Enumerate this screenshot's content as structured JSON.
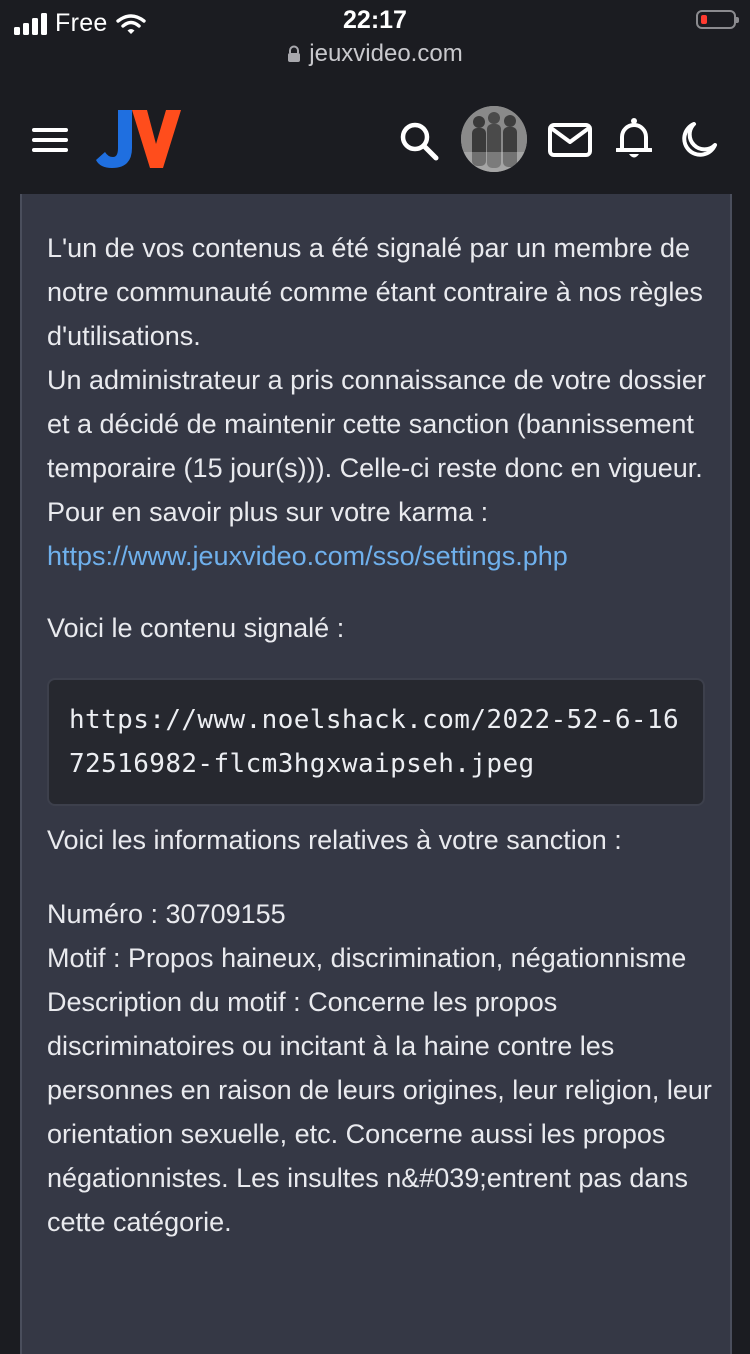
{
  "status_bar": {
    "carrier": "Free",
    "time": "22:17",
    "url": "jeuxvideo.com"
  },
  "header": {
    "logo_text": "JV",
    "icons": [
      "menu-icon",
      "search-icon",
      "avatar",
      "mail-icon",
      "bell-icon",
      "moon-icon"
    ]
  },
  "message": {
    "intro_lines": [
      "L'un de vos contenus a été signalé par un membre de notre communauté comme étant contraire à nos règles d'utilisations.",
      "Un administrateur a pris connaissance de votre dossier et a décidé de maintenir cette sanction (bannissement temporaire (15 jour(s))). Celle-ci reste donc en vigueur.",
      "Pour en savoir plus sur votre karma :"
    ],
    "karma_link": "https://www.jeuxvideo.com/sso/settings.php",
    "reported_heading": "Voici le contenu signalé :",
    "reported_content": "https://www.noelshack.com/2022-52-6-1672516982-flcm3hgxwaipseh.jpeg",
    "sanction_heading": "Voici les informations relatives à votre sanction :",
    "sanction": {
      "numero": "Numéro : 30709155",
      "motif": "Motif : Propos haineux, discrimination, négationnisme",
      "description": "Description du motif : Concerne les propos discriminatoires ou incitant à la haine contre les personnes en raison de leurs origines, leur religion, leur orientation sexuelle, etc. Concerne aussi les propos négationnistes. Les insultes n&#039;entrent pas dans cette catégorie."
    }
  },
  "colors": {
    "page_background": "#1b1c21",
    "card_background": "#353845",
    "link": "#6fb0ec",
    "logo_blue": "#1f6fe0",
    "logo_orange": "#ff4d1c",
    "battery_low": "#ff3b30"
  }
}
